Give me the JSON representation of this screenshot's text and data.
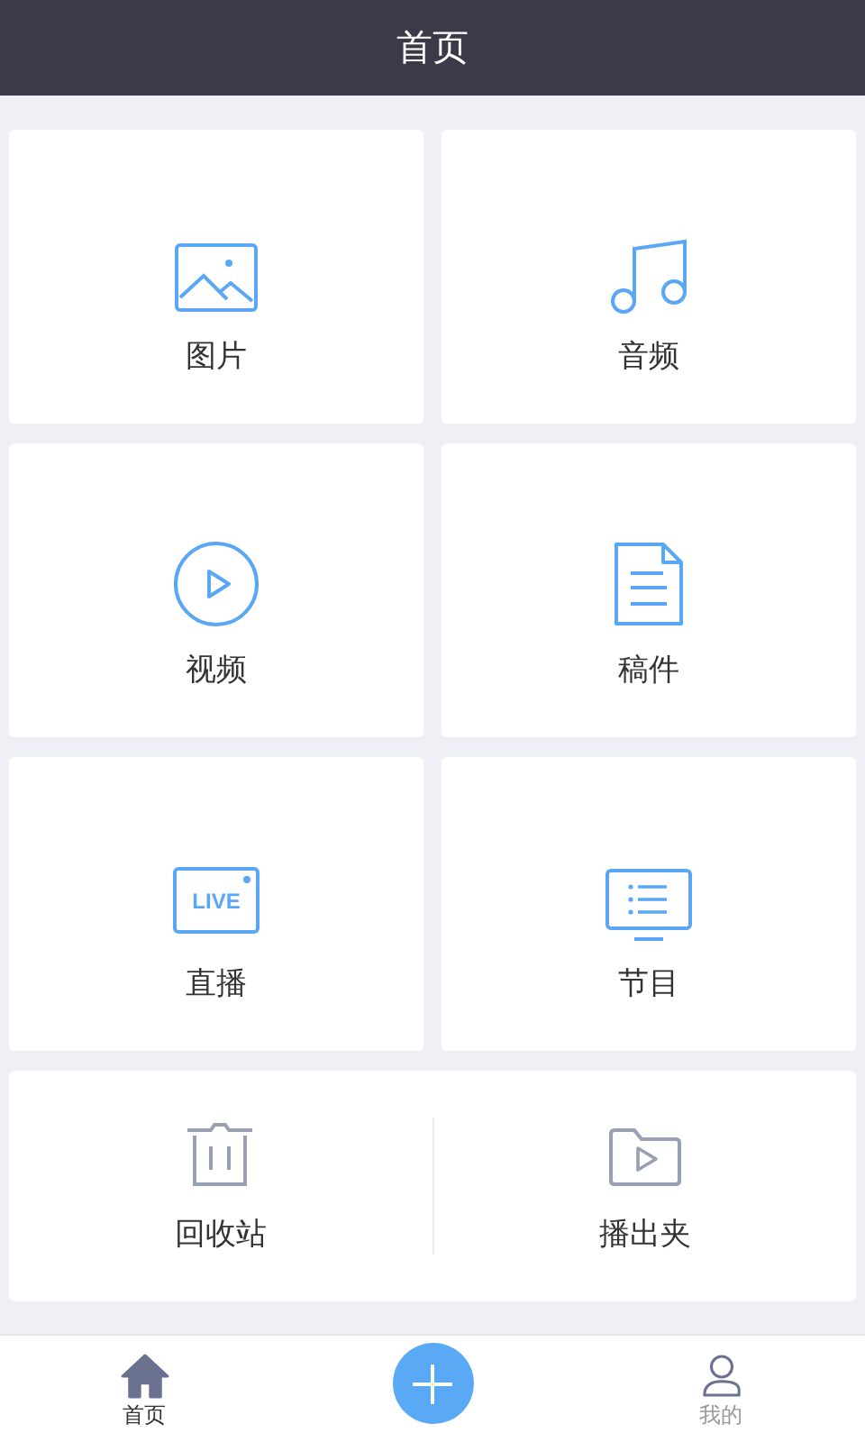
{
  "header": {
    "title": "首页"
  },
  "tiles": [
    {
      "kind": "image",
      "label": "图片"
    },
    {
      "kind": "music",
      "label": "音频"
    },
    {
      "kind": "video",
      "label": "视频"
    },
    {
      "kind": "document",
      "label": "稿件"
    },
    {
      "kind": "live",
      "label": "直播",
      "icon_text": "LIVE"
    },
    {
      "kind": "program",
      "label": "节目"
    }
  ],
  "tools": [
    {
      "kind": "trash",
      "label": "回收站"
    },
    {
      "kind": "folder",
      "label": "播出夹"
    }
  ],
  "tabbar": [
    {
      "kind": "home",
      "label": "首页",
      "selected": true
    },
    {
      "kind": "add"
    },
    {
      "kind": "user",
      "label": "我的",
      "selected": false
    }
  ]
}
